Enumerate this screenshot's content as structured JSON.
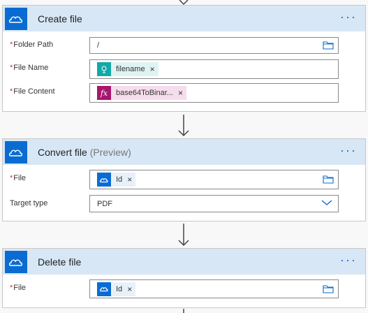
{
  "create_file": {
    "title": "Create file",
    "menu": "···",
    "folder_path_label": "Folder Path",
    "folder_path_value": "/",
    "file_name_label": "File Name",
    "file_name_token": "filename",
    "file_content_label": "File Content",
    "file_content_token": "base64ToBinar...",
    "token_remove": "×"
  },
  "convert_file": {
    "title": "Convert file",
    "title_suffix": "(Preview)",
    "menu": "···",
    "file_label": "File",
    "file_token": "Id",
    "target_type_label": "Target type",
    "target_type_value": "PDF",
    "token_remove": "×"
  },
  "delete_file": {
    "title": "Delete file",
    "menu": "···",
    "file_label": "File",
    "file_token": "Id",
    "token_remove": "×"
  },
  "required_marker": "*",
  "colors": {
    "accent": "#0a6cd2",
    "header_bg": "#d7e7f6",
    "required": "#d13438"
  }
}
